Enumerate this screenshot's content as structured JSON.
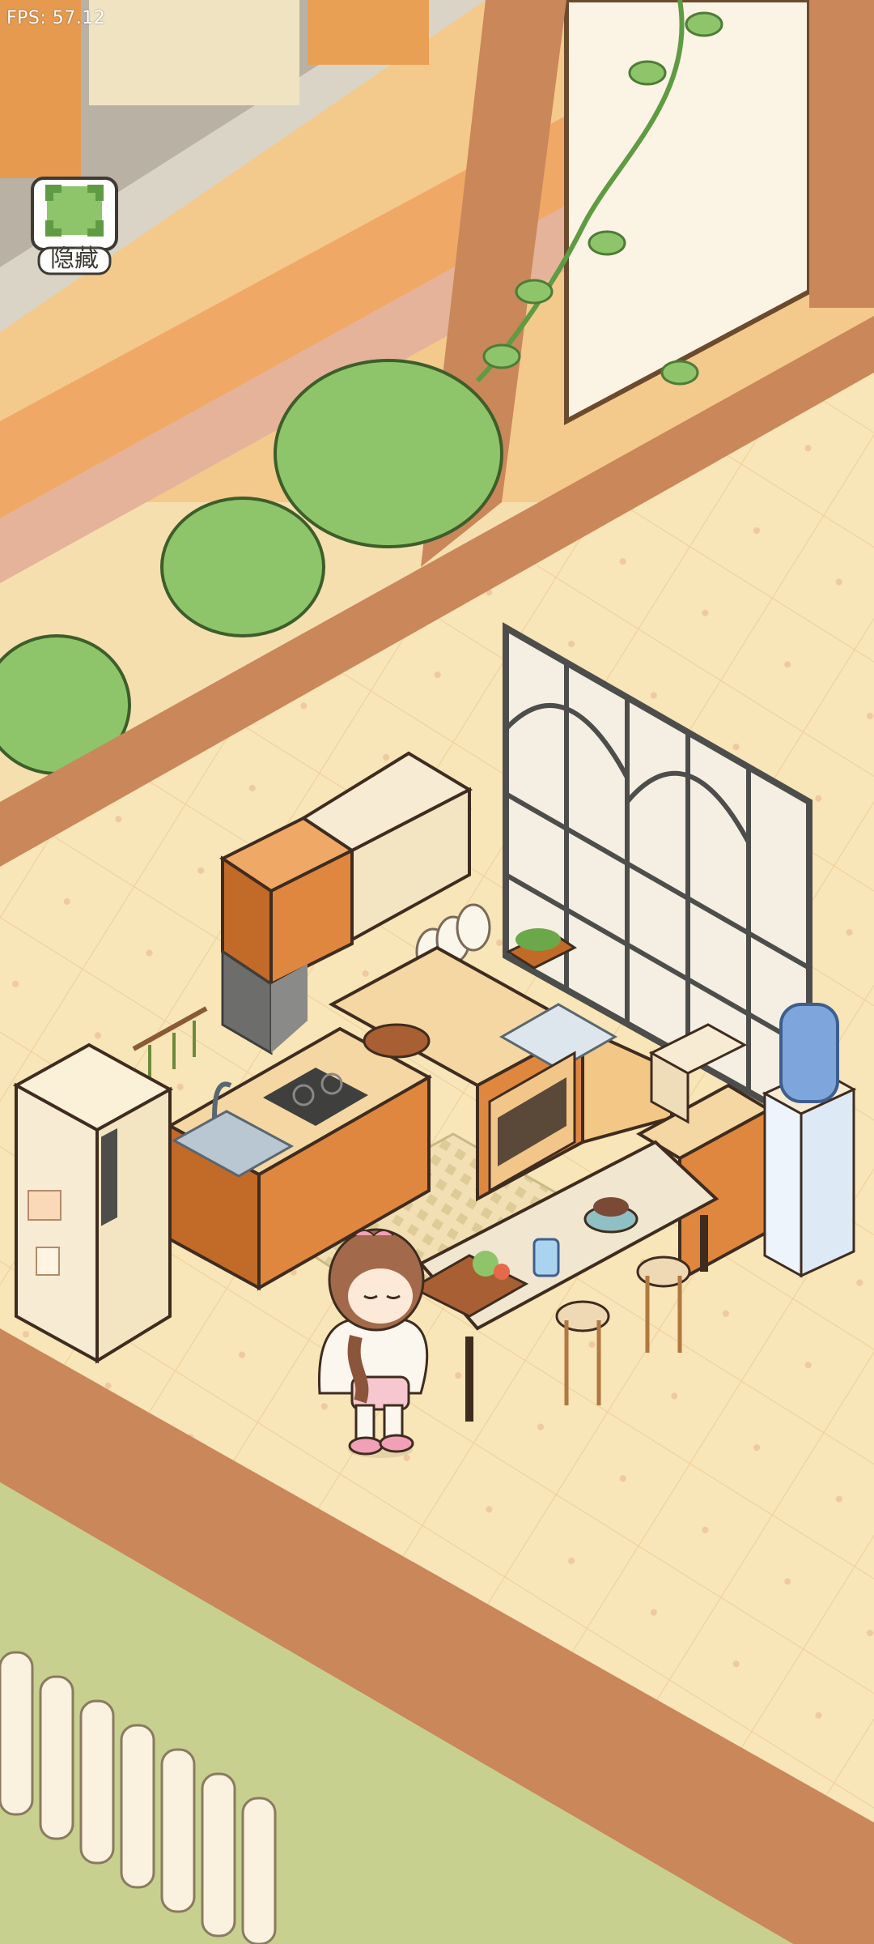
{
  "hud": {
    "fps_label": "FPS: 57.12",
    "hide_button_label": "隐藏",
    "hide_icon": "leaf-frame-icon"
  },
  "colors": {
    "floor": "#f7e2b4",
    "wall_top": "#f4c98c",
    "wood_beam": "#c9875a",
    "bush": "#8fc56a",
    "grass": "#c7d08e",
    "cabinet_orange": "#e0873f",
    "cabinet_cream": "#f3e4c2",
    "window_frame": "#5a5a58"
  }
}
